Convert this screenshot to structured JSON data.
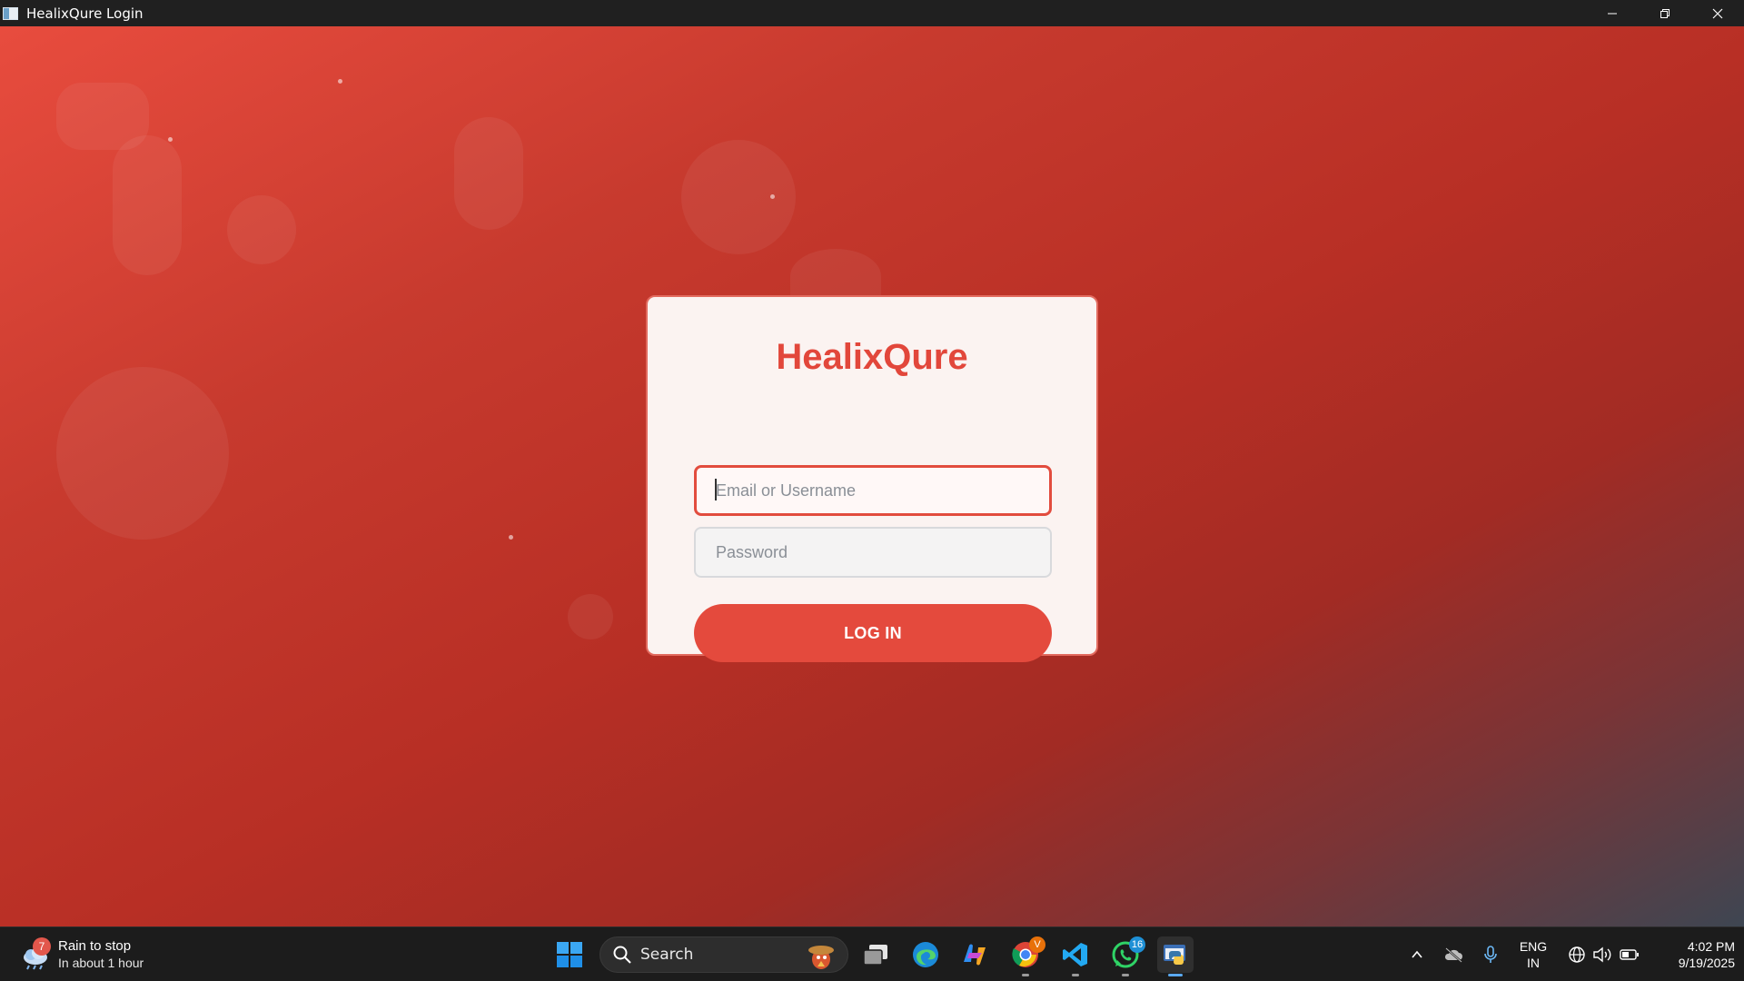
{
  "window": {
    "title": "HealixQure Login"
  },
  "login": {
    "brand": "HealixQure",
    "email_placeholder": "Email or Username",
    "password_placeholder": "Password",
    "login_label": "LOG IN"
  },
  "taskbar": {
    "weather": {
      "title": "Rain to stop",
      "subtitle": "In about 1 hour",
      "badge": "7"
    },
    "search_label": "Search",
    "apps": [
      {
        "name": "start",
        "icon": "windows-logo-icon"
      },
      {
        "name": "task-view",
        "icon": "task-view-icon"
      },
      {
        "name": "edge",
        "icon": "edge-browser-icon"
      },
      {
        "name": "copilot",
        "icon": "copilot-icon"
      },
      {
        "name": "chrome",
        "icon": "chrome-browser-icon",
        "badge": "V"
      },
      {
        "name": "vscode",
        "icon": "vscode-icon"
      },
      {
        "name": "whatsapp",
        "icon": "whatsapp-icon",
        "badge": "16"
      },
      {
        "name": "python",
        "icon": "python-app-icon"
      }
    ],
    "language": {
      "line1": "ENG",
      "line2": "IN"
    },
    "clock": {
      "time": "4:02 PM",
      "date": "9/19/2025"
    }
  },
  "colors": {
    "accent": "#e44a3d",
    "brand_text": "#e2473b",
    "taskbar": "#1c1c1c"
  }
}
